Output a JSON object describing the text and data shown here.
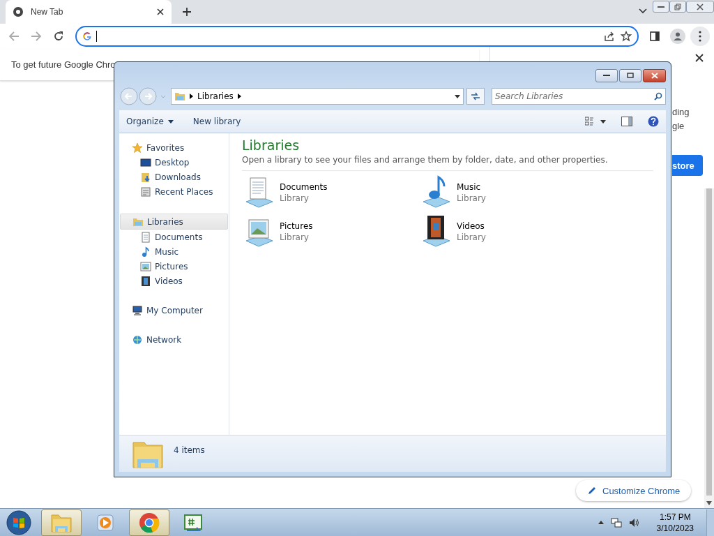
{
  "browser": {
    "tabs": [
      {
        "title": "New Tab",
        "selected": true
      }
    ],
    "infobar": {
      "text": "To get future Google Chro"
    },
    "side_panel": {
      "lines": [
        "ding",
        "gle"
      ],
      "button": "store"
    },
    "customize_button": "Customize Chrome"
  },
  "explorer": {
    "breadcrumb": [
      "Libraries"
    ],
    "search": {
      "placeholder": "Search Libraries"
    },
    "toolbar": [
      {
        "label": "Organize",
        "kind": "menu"
      },
      {
        "label": "New library",
        "kind": "plain"
      }
    ],
    "nav": [
      {
        "label": "Favorites",
        "selected": false,
        "children": [
          {
            "label": "Desktop",
            "selected": false
          },
          {
            "label": "Downloads",
            "selected": false
          },
          {
            "label": "Recent Places",
            "selected": false
          }
        ]
      },
      {
        "label": "Libraries",
        "selected": true,
        "children": [
          {
            "label": "Documents",
            "selected": false
          },
          {
            "label": "Music",
            "selected": false
          },
          {
            "label": "Pictures",
            "selected": false
          },
          {
            "label": "Videos",
            "selected": false
          }
        ]
      },
      {
        "label": "My Computer",
        "selected": false
      },
      {
        "label": "Network",
        "selected": false
      }
    ],
    "heading": "Libraries",
    "description": "Open a library to see your files and arrange them by folder, date, and other properties.",
    "items": [
      {
        "name": "Documents",
        "subtitle": "Library"
      },
      {
        "name": "Music",
        "subtitle": "Library"
      },
      {
        "name": "Pictures",
        "subtitle": "Library"
      },
      {
        "name": "Videos",
        "subtitle": "Library"
      }
    ],
    "status": "4 items"
  },
  "taskbar": {
    "apps": [
      {
        "selected": true
      },
      {
        "selected": false
      },
      {
        "selected": true
      },
      {
        "selected": false
      }
    ],
    "time": "1:57 PM",
    "date": "3/10/2023"
  }
}
